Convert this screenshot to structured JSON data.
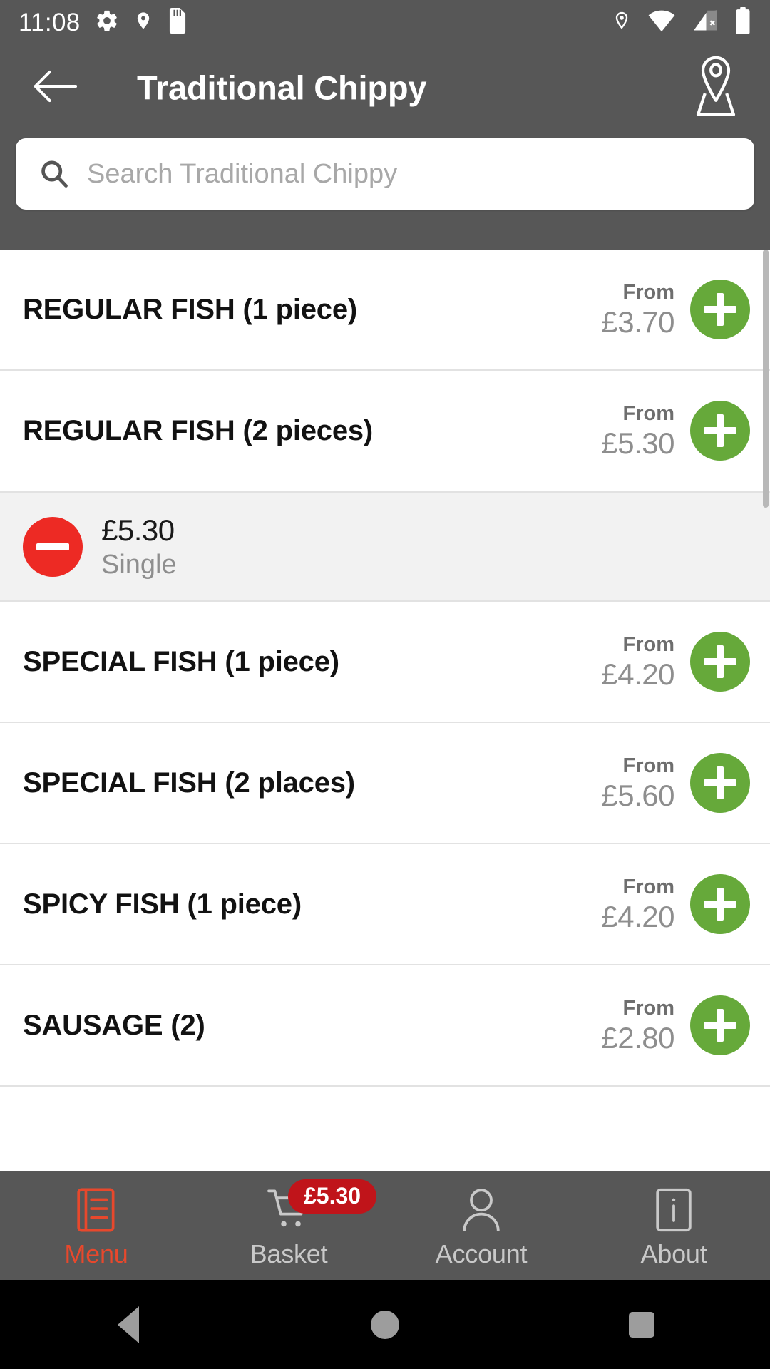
{
  "status_bar": {
    "time": "11:08",
    "left_icons": [
      "gear-icon",
      "location-pin-icon",
      "sd-card-icon"
    ],
    "right_icons": [
      "location-pin-icon",
      "wifi-icon",
      "signal-off-icon",
      "battery-full-icon"
    ]
  },
  "app_bar": {
    "back_icon": "back-arrow-icon",
    "title": "Traditional Chippy",
    "map_icon": "map-location-icon"
  },
  "search": {
    "icon": "search-icon",
    "placeholder": "Search Traditional Chippy",
    "value": ""
  },
  "menu": {
    "from_label": "From",
    "add_icon": "plus-icon",
    "remove_icon": "minus-icon",
    "items": [
      {
        "name": "REGULAR FISH (1 piece)",
        "from": "From",
        "price": "£3.70",
        "expanded": false
      },
      {
        "name": "REGULAR FISH (2 pieces)",
        "from": "From",
        "price": "£5.30",
        "expanded": true,
        "selection": {
          "price": "£5.30",
          "label": "Single"
        }
      },
      {
        "name": "SPECIAL FISH (1 piece)",
        "from": "From",
        "price": "£4.20",
        "expanded": false
      },
      {
        "name": "SPECIAL FISH (2 places)",
        "from": "From",
        "price": "£5.60",
        "expanded": false
      },
      {
        "name": "SPICY FISH (1 piece)",
        "from": "From",
        "price": "£4.20",
        "expanded": false
      },
      {
        "name": "SAUSAGE (2)",
        "from": "From",
        "price": "£2.80",
        "expanded": false
      }
    ]
  },
  "bottom_nav": {
    "items": [
      {
        "label": "Menu",
        "icon": "menu-list-icon",
        "active": true
      },
      {
        "label": "Basket",
        "icon": "shopping-cart-icon",
        "active": false,
        "badge": "£5.30"
      },
      {
        "label": "Account",
        "icon": "person-icon",
        "active": false
      },
      {
        "label": "About",
        "icon": "info-icon",
        "active": false
      }
    ]
  },
  "android_nav": {
    "back": "android-back-button",
    "home": "android-home-button",
    "recents": "android-recents-button"
  },
  "colors": {
    "chrome": "#575757",
    "accent_green": "#66a93a",
    "accent_red": "#ed2a24",
    "badge_red": "#c0141a",
    "active_nav": "#e8482c"
  }
}
